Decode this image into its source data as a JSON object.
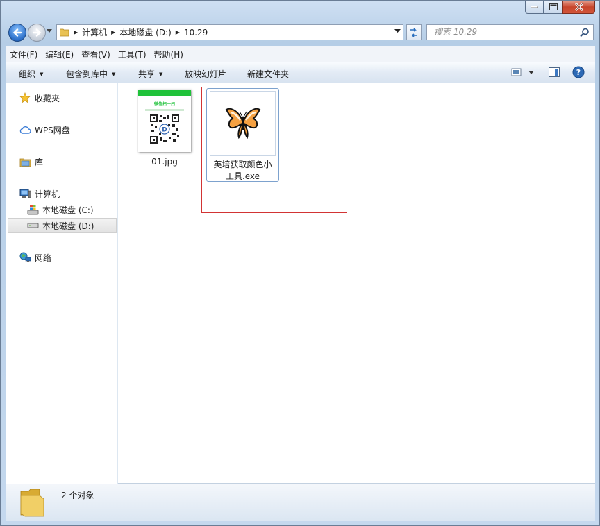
{
  "window": {
    "buttons": {
      "minimize": "minimize",
      "maximize": "maximize",
      "close": "close"
    }
  },
  "nav": {
    "breadcrumbs": [
      "计算机",
      "本地磁盘 (D:)",
      "10.29"
    ],
    "search_placeholder": "搜索 10.29"
  },
  "menu": {
    "items": [
      "文件(F)",
      "编辑(E)",
      "查看(V)",
      "工具(T)",
      "帮助(H)"
    ]
  },
  "toolbar": {
    "organize": "组织",
    "include_library": "包含到库中",
    "share": "共享",
    "slideshow": "放映幻灯片",
    "new_folder": "新建文件夹"
  },
  "sidebar": {
    "items": [
      {
        "label": "收藏夹",
        "icon": "star-icon"
      },
      {
        "label": "WPS网盘",
        "icon": "cloud-icon"
      },
      {
        "label": "库",
        "icon": "library-icon"
      },
      {
        "label": "计算机",
        "icon": "computer-icon"
      },
      {
        "label": "本地磁盘 (C:)",
        "icon": "system-drive-icon"
      },
      {
        "label": "本地磁盘 (D:)",
        "icon": "drive-icon",
        "selected": true
      },
      {
        "label": "网络",
        "icon": "network-icon"
      }
    ]
  },
  "files": [
    {
      "name": "01.jpg",
      "type": "image",
      "thumb_header": "微信扫一扫",
      "icon": "qr-thumbnail-icon"
    },
    {
      "name_line1": "英培获取颜色小",
      "name_line2": "工具.exe",
      "type": "exe",
      "icon": "butterfly-icon",
      "selected": true
    }
  ],
  "status": {
    "text": "2 个对象"
  },
  "colors": {
    "highlight_box": "#d23434",
    "selection_border": "#7da2ce",
    "thumb_green": "#1fc23a"
  }
}
